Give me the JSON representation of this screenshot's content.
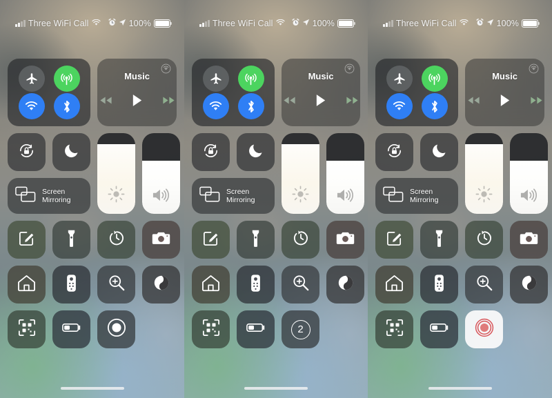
{
  "status_bar": {
    "carrier": "Three WiFi Call",
    "battery_percent": "100%",
    "signal_icon": "cellular-signal-icon",
    "wifi_icon": "wifi-icon",
    "alarm_icon": "alarm-clock-icon",
    "location_icon": "location-arrow-icon",
    "battery_icon": "battery-full-icon",
    "battery_fill": 100
  },
  "connectivity": {
    "airplane": {
      "label": "Airplane Mode",
      "icon": "airplane-icon",
      "state": "off"
    },
    "cellular": {
      "label": "Cellular Data",
      "icon": "cellular-data-icon",
      "state": "on",
      "color": "#4cd45f"
    },
    "wifi": {
      "label": "Wi-Fi",
      "icon": "wifi-icon",
      "state": "on",
      "color": "#2f7ff5"
    },
    "bluetooth": {
      "label": "Bluetooth",
      "icon": "bluetooth-icon",
      "state": "on",
      "color": "#2f7ff5"
    }
  },
  "music": {
    "title": "Music",
    "airplay_icon": "airplay-audio-icon",
    "rewind_icon": "rewind-icon",
    "play_icon": "play-icon",
    "forward_icon": "fast-forward-icon"
  },
  "toggles": {
    "rotation_lock": {
      "label": "Rotation Lock",
      "icon": "rotation-lock-icon"
    },
    "do_not_disturb": {
      "label": "Do Not Disturb",
      "icon": "moon-icon"
    },
    "screen_mirroring": {
      "label_line1": "Screen",
      "label_line2": "Mirroring",
      "icon": "screen-mirroring-icon"
    }
  },
  "sliders": {
    "brightness": {
      "label": "Brightness",
      "icon": "brightness-icon",
      "value": 86
    },
    "volume": {
      "label": "Volume",
      "icon": "volume-icon",
      "value": 66
    }
  },
  "grid": [
    {
      "name": "notes",
      "label": "Notes",
      "icon": "notes-pencil-icon",
      "tint": "t-notes"
    },
    {
      "name": "flashlight",
      "label": "Flashlight",
      "icon": "flashlight-icon",
      "tint": "t-torch"
    },
    {
      "name": "timer",
      "label": "Timer",
      "icon": "timer-icon",
      "tint": "t-timer"
    },
    {
      "name": "camera",
      "label": "Camera",
      "icon": "camera-icon",
      "tint": "t-camera"
    },
    {
      "name": "home",
      "label": "Home",
      "icon": "home-icon",
      "tint": "t-home"
    },
    {
      "name": "remote",
      "label": "Apple TV Remote",
      "icon": "tv-remote-icon",
      "tint": "t-remote"
    },
    {
      "name": "magnifier",
      "label": "Magnifier",
      "icon": "magnifier-plus-icon",
      "tint": "t-magnify"
    },
    {
      "name": "dark-mode",
      "label": "Dark Mode",
      "icon": "dark-mode-contrast-icon",
      "tint": "t-dark"
    },
    {
      "name": "qr-scanner",
      "label": "Code Scanner",
      "icon": "qr-code-icon",
      "tint": "t-qr"
    },
    {
      "name": "low-power",
      "label": "Low Power Mode",
      "icon": "battery-low-icon",
      "tint": "t-power"
    }
  ],
  "screen_record": {
    "panel1": {
      "state": "idle",
      "icon": "record-circle-icon",
      "label": "Screen Recording"
    },
    "panel2": {
      "state": "countdown",
      "icon": "countdown-icon",
      "value": "2",
      "label": "Screen Recording"
    },
    "panel3": {
      "state": "recording",
      "icon": "record-circle-active-icon",
      "label": "Screen Recording",
      "color": "#d8565a"
    }
  },
  "colors": {
    "green": "#4cd45f",
    "blue": "#2f7ff5",
    "record_red": "#d8565a",
    "tile_dark": "#303234"
  }
}
